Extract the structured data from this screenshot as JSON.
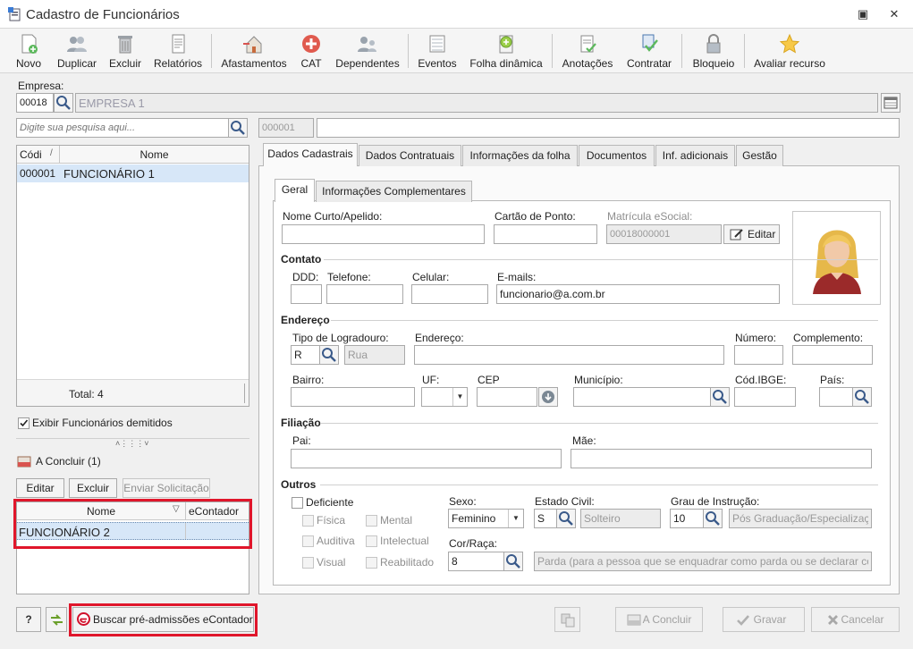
{
  "window": {
    "title": "Cadastro de Funcionários"
  },
  "toolbar": {
    "novo": "Novo",
    "duplicar": "Duplicar",
    "excluir": "Excluir",
    "relatorios": "Relatórios",
    "afastamentos": "Afastamentos",
    "cat": "CAT",
    "dependentes": "Dependentes",
    "eventos": "Eventos",
    "folha_dinamica": "Folha dinâmica",
    "anotacoes": "Anotações",
    "contratar": "Contratar",
    "bloqueio": "Bloqueio",
    "avaliar": "Avaliar recurso"
  },
  "empresa": {
    "label": "Empresa:",
    "code": "00018",
    "name": "EMPRESA 1"
  },
  "search": {
    "placeholder": "Digite sua pesquisa aqui...",
    "code": "000001",
    "name": ""
  },
  "employees": {
    "col_code": "Códi",
    "col_name": "Nome",
    "rows": [
      {
        "code": "000001",
        "name": "FUNCIONÁRIO 1"
      }
    ],
    "total": "Total: 4"
  },
  "demitidos_label": "Exibir Funcionários demitidos",
  "concluir": {
    "title": "A Concluir (1)",
    "editar": "Editar",
    "excluir": "Excluir",
    "enviar": "Enviar Solicitação",
    "col_name": "Nome",
    "col_econtador": "eContador",
    "rows": [
      {
        "name": "FUNCIONÁRIO 2",
        "econtador": ""
      }
    ]
  },
  "tabs": {
    "dados": "Dados Cadastrais",
    "contratuais": "Dados Contratuais",
    "folha": "Informações da folha",
    "documentos": "Documentos",
    "adicionais": "Inf. adicionais",
    "gestao": "Gestão"
  },
  "subtabs": {
    "geral": "Geral",
    "compl": "Informações Complementares"
  },
  "form": {
    "nome_curto": "Nome Curto/Apelido:",
    "cartao": "Cartão de Ponto:",
    "matricula": "Matrícula eSocial:",
    "matricula_value": "00018000001",
    "editar": "Editar",
    "contato": "Contato",
    "ddd": "DDD:",
    "telefone": "Telefone:",
    "celular": "Celular:",
    "emails": "E-mails:",
    "email_value": "funcionario@a.com.br",
    "endereco_sec": "Endereço",
    "tipo_log": "Tipo de Logradouro:",
    "tipo_code": "R",
    "tipo_name": "Rua",
    "endereco": "Endereço:",
    "numero": "Número:",
    "complemento": "Complemento:",
    "bairro": "Bairro:",
    "uf": "UF:",
    "cep": "CEP",
    "municipio": "Município:",
    "cod_ibge": "Cód.IBGE:",
    "pais": "País:",
    "filiacao": "Filiação",
    "pai": "Pai:",
    "mae": "Mãe:",
    "outros": "Outros",
    "deficiente": "Deficiente",
    "fisica": "Física",
    "mental": "Mental",
    "auditiva": "Auditiva",
    "intelectual": "Intelectual",
    "visual": "Visual",
    "reabilitado": "Reabilitado",
    "sexo": "Sexo:",
    "sexo_value": "Feminino",
    "estado_civil": "Estado Civil:",
    "ec_code": "S",
    "ec_name": "Solteiro",
    "grau": "Grau de Instrução:",
    "grau_code": "10",
    "grau_name": "Pós Graduação/Especialização",
    "cor": "Cor/Raça:",
    "cor_code": "8",
    "cor_name": "Parda (para a pessoa que se enquadrar como parda ou se declarar como"
  },
  "bottom": {
    "help": "?",
    "buscar": "Buscar pré-admissões eContador",
    "concluir": "A Concluir",
    "gravar": "Gravar",
    "cancelar": "Cancelar"
  }
}
